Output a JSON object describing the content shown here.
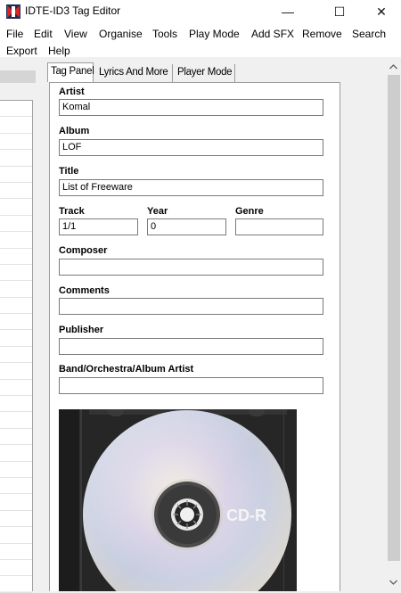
{
  "window": {
    "title": "IDTE-ID3 Tag Editor",
    "minimize": "—",
    "maximize": "☐",
    "close": "✕"
  },
  "menu": {
    "items": [
      "File",
      "Edit",
      "View",
      "Organise",
      "Tools",
      "Play Mode",
      "Add SFX",
      "Remove",
      "Search",
      "Export",
      "Help"
    ]
  },
  "tabs": [
    "Tag Panel",
    "Lyrics And More",
    "Player Mode"
  ],
  "fields": {
    "artist": {
      "label": "Artist",
      "value": "Komal"
    },
    "album": {
      "label": "Album",
      "value": "LOF"
    },
    "title": {
      "label": "Title",
      "value": "List of Freeware"
    },
    "track": {
      "label": "Track",
      "value": "1/1"
    },
    "year": {
      "label": "Year",
      "value": "0"
    },
    "genre": {
      "label": "Genre",
      "value": ""
    },
    "composer": {
      "label": "Composer",
      "value": ""
    },
    "comments": {
      "label": "Comments",
      "value": ""
    },
    "publisher": {
      "label": "Publisher",
      "value": ""
    },
    "band": {
      "label": "Band/Orchestra/Album Artist",
      "value": ""
    }
  },
  "cover": {
    "disc_text": "CD-R"
  },
  "scrollbar": {
    "up_icon": "chevron-up",
    "down_icon": "chevron-down"
  },
  "colors": {
    "panel_border": "#9c9c9c",
    "input_border": "#7a7a7a",
    "scroll_thumb": "#cdcdcd"
  }
}
